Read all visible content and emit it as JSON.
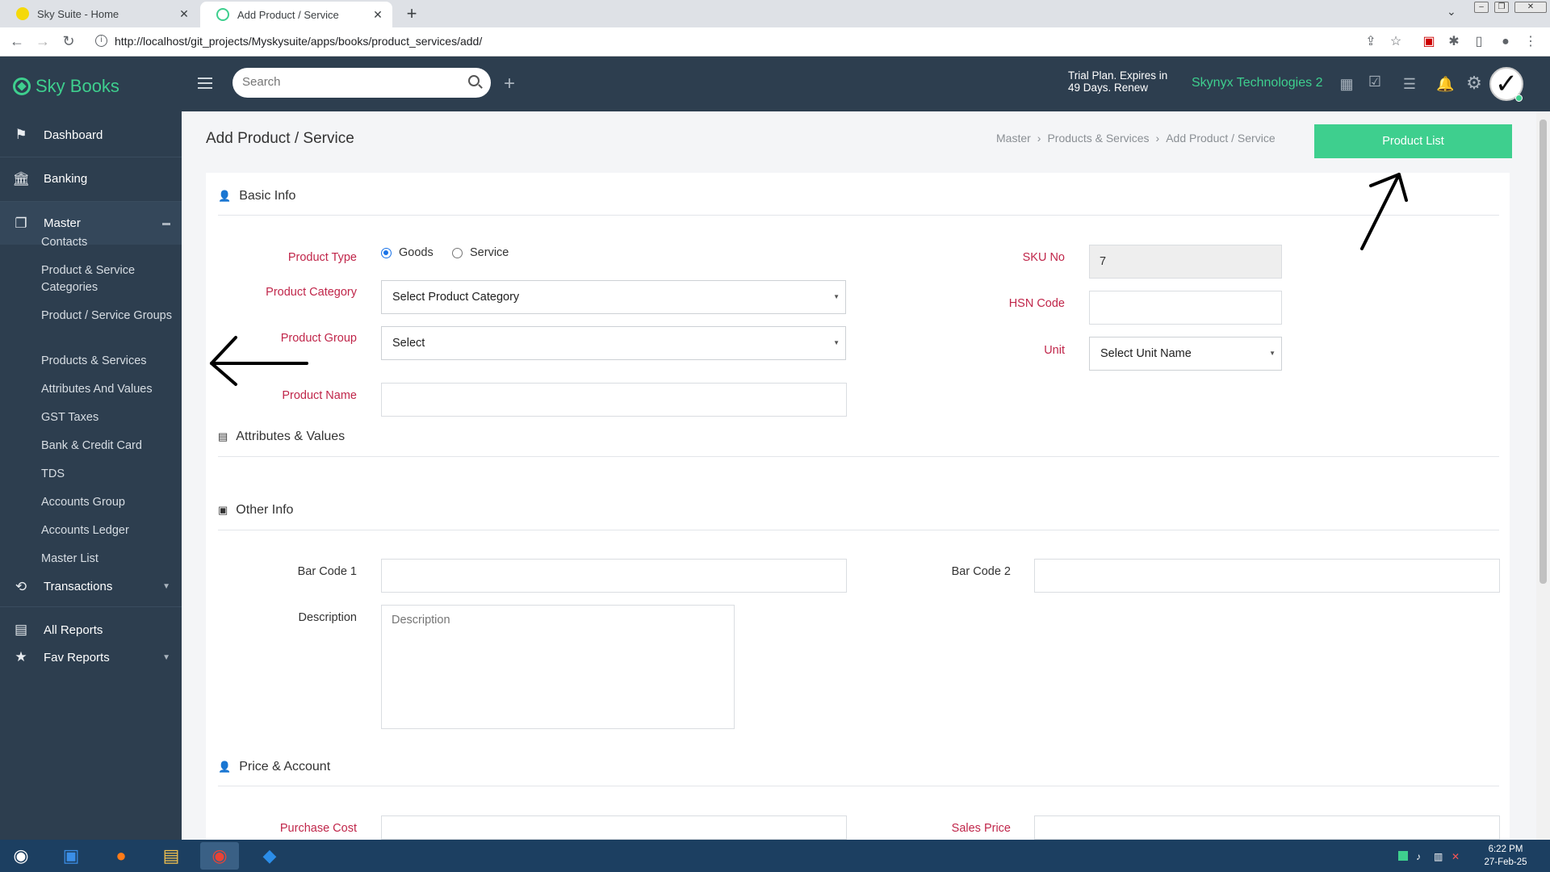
{
  "browser": {
    "tabs": [
      {
        "title": "Sky Suite - Home",
        "active": false
      },
      {
        "title": "Add Product / Service",
        "active": true
      }
    ],
    "url": "http://localhost/git_projects/Myskysuite/apps/books/product_services/add/"
  },
  "app": {
    "name": "Sky Books",
    "search_placeholder": "Search",
    "trial_line1": "Trial Plan. Expires in",
    "trial_line2": "49 Days. Renew",
    "company": "Skynyx Technologies 2"
  },
  "sidebar": {
    "items": [
      {
        "label": "Dashboard",
        "icon": "flag-icon"
      },
      {
        "label": "Banking",
        "icon": "bank-icon"
      },
      {
        "label": "Master",
        "icon": "master-icon",
        "expanded": true
      },
      {
        "label": "Transactions",
        "icon": "transactions-icon"
      },
      {
        "label": "All Reports",
        "icon": "report-icon"
      },
      {
        "label": "Fav Reports",
        "icon": "star-icon"
      }
    ],
    "master_sub": [
      "Contacts",
      "Product & Service Categories",
      "Product / Service Groups",
      "Products & Services",
      "Attributes And Values",
      "GST Taxes",
      "Bank & Credit Card",
      "TDS",
      "Accounts Group",
      "Accounts Ledger",
      "Master List"
    ]
  },
  "page": {
    "title": "Add Product / Service",
    "breadcrumb": [
      "Master",
      "Products & Services",
      "Add Product / Service"
    ],
    "product_list_button": "Product List"
  },
  "form": {
    "sections": {
      "basic_info": "Basic Info",
      "attributes": "Attributes & Values",
      "other_info": "Other Info",
      "price": "Price & Account"
    },
    "product_type_label": "Product Type",
    "product_type_options": [
      "Goods",
      "Service"
    ],
    "product_type_selected": "Goods",
    "product_category_label": "Product Category",
    "product_category_value": "Select Product Category",
    "product_group_label": "Product Group",
    "product_group_value": "Select",
    "product_name_label": "Product Name",
    "product_name_value": "",
    "sku_label": "SKU No",
    "sku_value": "7",
    "hsn_label": "HSN Code",
    "hsn_value": "",
    "unit_label": "Unit",
    "unit_value": "Select Unit Name",
    "barcode1_label": "Bar Code 1",
    "barcode1_value": "",
    "barcode2_label": "Bar Code 2",
    "barcode2_value": "",
    "description_label": "Description",
    "description_placeholder": "Description",
    "purchase_cost_label": "Purchase Cost",
    "sales_price_label": "Sales Price"
  },
  "taskbar": {
    "time": "6:22 PM",
    "date": "27-Feb-25"
  },
  "colors": {
    "sidebar_bg": "#2d3e4f",
    "accent": "#3ecf8e",
    "label_red": "#c0264a"
  }
}
